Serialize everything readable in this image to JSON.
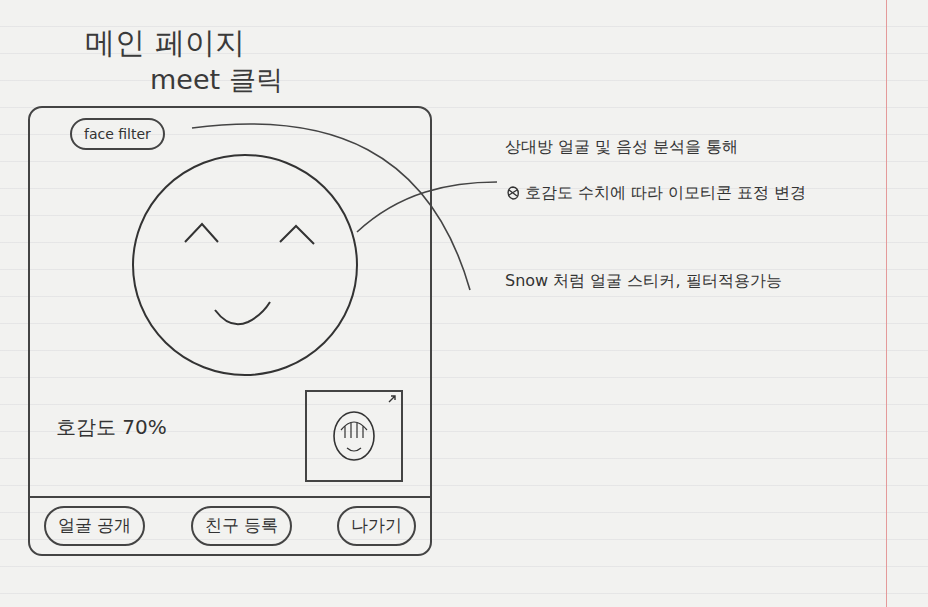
{
  "page": {
    "title": "메인 페이지",
    "subtitle": "meet 클릭"
  },
  "filter_button": "face filter",
  "affinity": {
    "label": "호감도 70%"
  },
  "buttons": [
    "얼굴 공개",
    "친구 등록",
    "나가기"
  ],
  "notes": [
    "상대방 얼굴 및 음성 분석을 통해",
    "호감도 수치에 따라 이모티콘 표정 변경",
    "Snow 처럼 얼굴 스티커, 필터적용가능"
  ]
}
